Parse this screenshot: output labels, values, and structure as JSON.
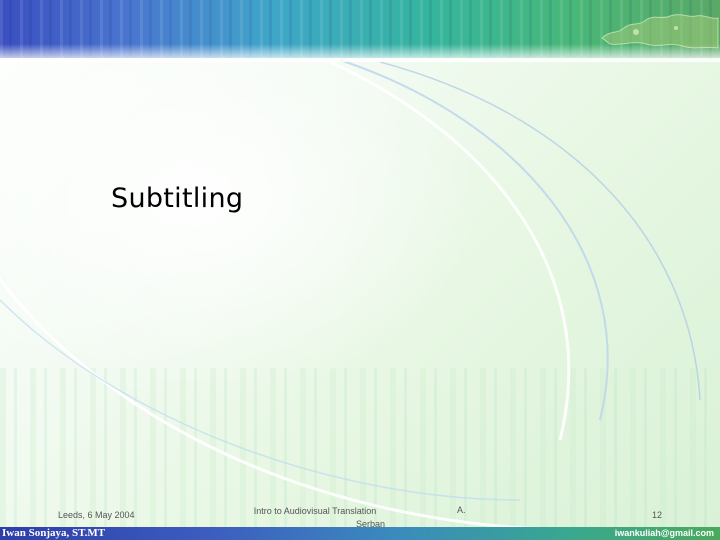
{
  "slide": {
    "title": "Subtitling",
    "footer": {
      "date": "Leeds, 6 May 2004",
      "center_line1": "Intro to Audiovisual Translation",
      "center_line2": "Serban",
      "initial": "A.",
      "page_number": "12"
    },
    "bottom_bar": {
      "author": "Iwan Sonjaya, ST.MT",
      "email": "iwankuliah@gmail.com"
    }
  },
  "colors": {
    "banner_start": "#3a4fc0",
    "banner_end": "#5aa866",
    "background_tint": "#e7f7e3",
    "title_text": "#000000"
  }
}
